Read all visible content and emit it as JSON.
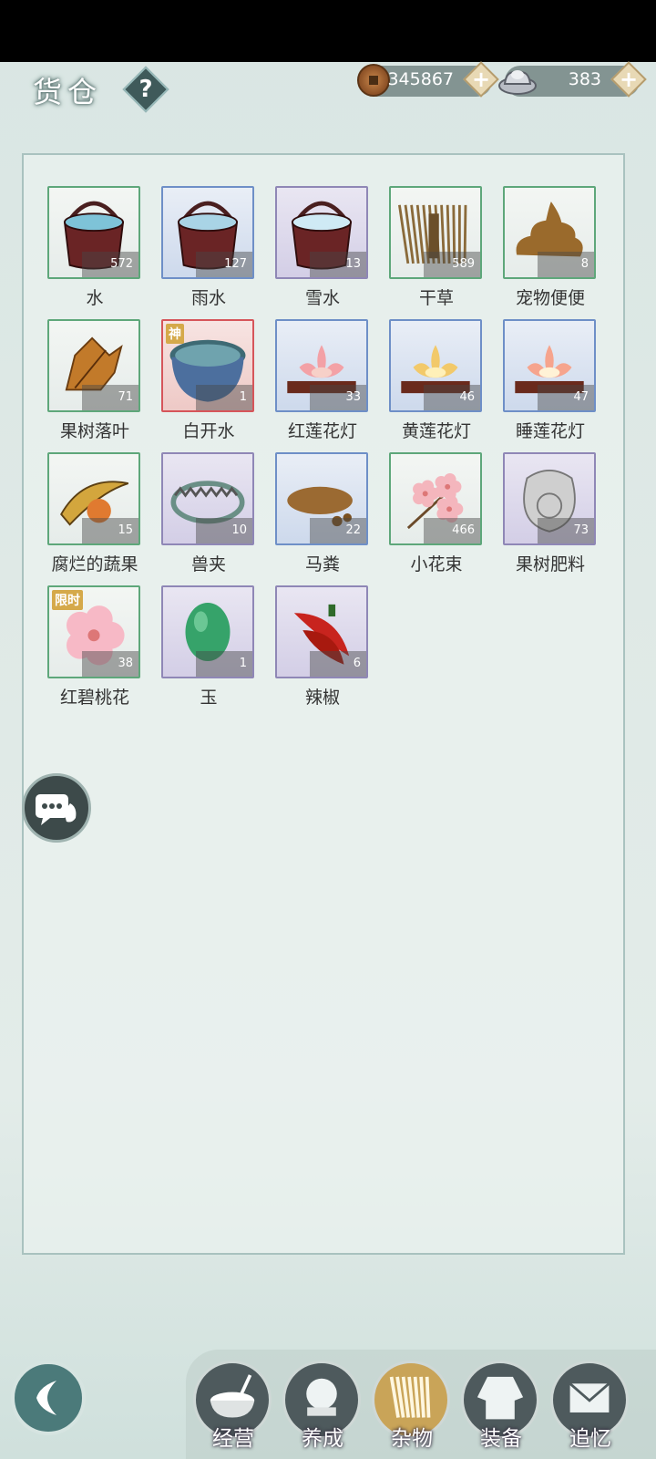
{
  "header": {
    "title": "货仓",
    "help_label": "?"
  },
  "currency": {
    "coins": "345867",
    "silver": "383",
    "plus_label": "+"
  },
  "items": [
    {
      "name": "水",
      "count": "572",
      "rarity": "green",
      "icon": "wooden-bucket-water-icon",
      "tag": ""
    },
    {
      "name": "雨水",
      "count": "127",
      "rarity": "blue",
      "icon": "wooden-bucket-rain-icon",
      "tag": ""
    },
    {
      "name": "雪水",
      "count": "13",
      "rarity": "purple",
      "icon": "wooden-bucket-snow-icon",
      "tag": ""
    },
    {
      "name": "干草",
      "count": "589",
      "rarity": "green",
      "icon": "hay-bundle-icon",
      "tag": ""
    },
    {
      "name": "宠物便便",
      "count": "8",
      "rarity": "green",
      "icon": "pet-poop-icon",
      "tag": ""
    },
    {
      "name": "果树落叶",
      "count": "71",
      "rarity": "green",
      "icon": "fallen-leaf-icon",
      "tag": ""
    },
    {
      "name": "白开水",
      "count": "1",
      "rarity": "red",
      "icon": "water-bowl-icon",
      "tag": "神"
    },
    {
      "name": "红莲花灯",
      "count": "33",
      "rarity": "blue",
      "icon": "red-lotus-lamp-icon",
      "tag": ""
    },
    {
      "name": "黄莲花灯",
      "count": "46",
      "rarity": "blue",
      "icon": "yellow-lotus-lamp-icon",
      "tag": ""
    },
    {
      "name": "睡莲花灯",
      "count": "47",
      "rarity": "blue",
      "icon": "water-lily-lamp-icon",
      "tag": ""
    },
    {
      "name": "腐烂的蔬果",
      "count": "15",
      "rarity": "green",
      "icon": "rotten-fruit-icon",
      "tag": ""
    },
    {
      "name": "兽夹",
      "count": "10",
      "rarity": "purple",
      "icon": "beast-trap-icon",
      "tag": ""
    },
    {
      "name": "马粪",
      "count": "22",
      "rarity": "blue",
      "icon": "horse-dung-icon",
      "tag": ""
    },
    {
      "name": "小花束",
      "count": "466",
      "rarity": "green",
      "icon": "flower-bouquet-icon",
      "tag": ""
    },
    {
      "name": "果树肥料",
      "count": "73",
      "rarity": "purple",
      "icon": "fertilizer-bag-icon",
      "tag": ""
    },
    {
      "name": "红碧桃花",
      "count": "38",
      "rarity": "green",
      "icon": "peach-blossom-icon",
      "tag": "限时"
    },
    {
      "name": "玉",
      "count": "1",
      "rarity": "purple",
      "icon": "jade-stone-icon",
      "tag": ""
    },
    {
      "name": "辣椒",
      "count": "6",
      "rarity": "purple",
      "icon": "chili-pepper-icon",
      "tag": ""
    }
  ],
  "nav": [
    {
      "label": "经营",
      "icon": "cooking-bowl-icon",
      "active": false
    },
    {
      "label": "养成",
      "icon": "crystal-ball-icon",
      "active": false
    },
    {
      "label": "杂物",
      "icon": "hay-bundle-icon",
      "active": true
    },
    {
      "label": "装备",
      "icon": "robe-icon",
      "active": false
    },
    {
      "label": "追忆",
      "icon": "letter-icon",
      "active": false
    }
  ],
  "colors": {
    "green": "#5ea77a",
    "blue": "#6e8fc7",
    "purple": "#8f87b6",
    "red": "#d6555a",
    "gold": "#c9a458"
  }
}
